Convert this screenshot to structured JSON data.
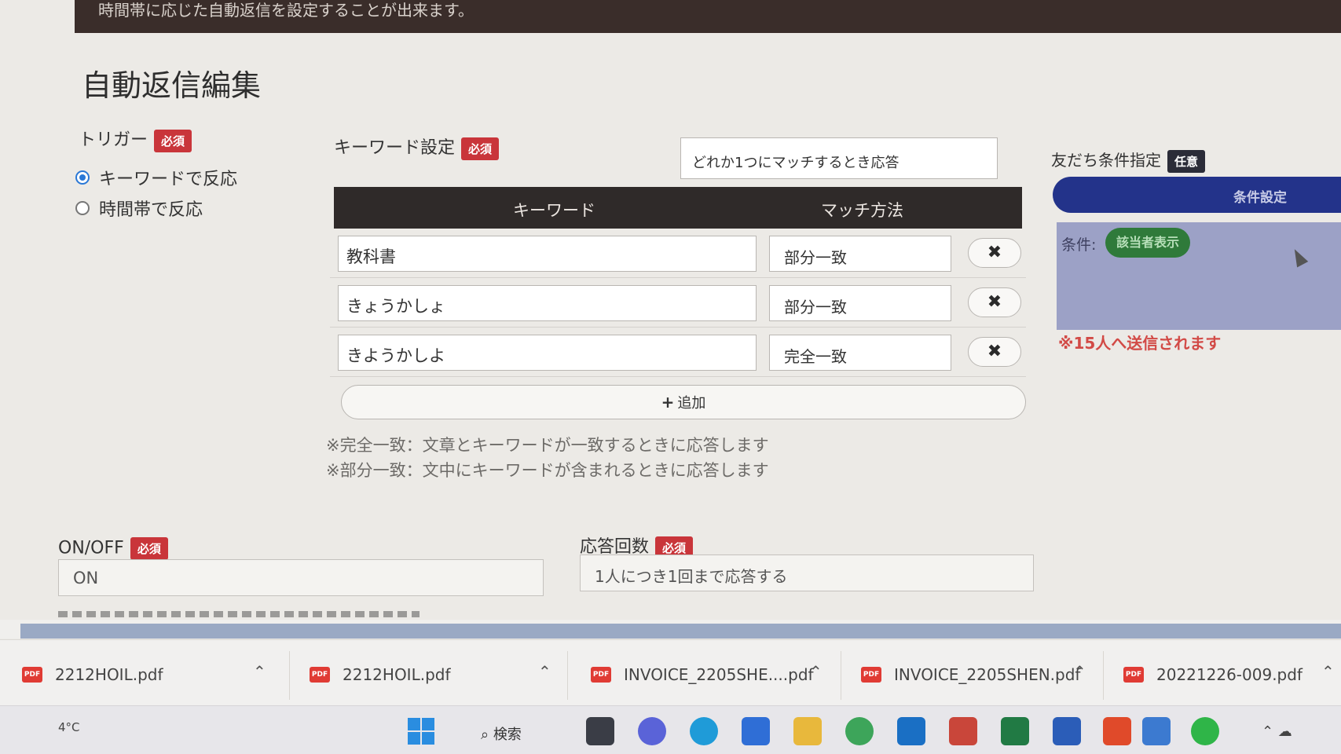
{
  "banner": {
    "text": "時間帯に応じた自動返信を設定することが出来ます。"
  },
  "page": {
    "title": "自動返信編集"
  },
  "badges": {
    "required": "必須",
    "optional": "任意"
  },
  "trigger": {
    "label": "トリガー",
    "options": [
      {
        "label": "キーワードで反応",
        "selected": true
      },
      {
        "label": "時間帯で反応",
        "selected": false
      }
    ]
  },
  "keywords": {
    "label": "キーワード設定",
    "match_mode": "どれか1つにマッチするとき応答",
    "columns": [
      "キーワード",
      "マッチ方法"
    ],
    "rows": [
      {
        "keyword": "教科書",
        "match": "部分一致"
      },
      {
        "keyword": "きょうかしょ",
        "match": "部分一致"
      },
      {
        "keyword": "きようかしよ",
        "match": "完全一致"
      }
    ],
    "delete_symbol": "✖",
    "add_label": "追加",
    "notes": [
      "※完全一致：文章とキーワードが一致するときに応答します",
      "※部分一致：文中にキーワードが含まれるときに応答します"
    ]
  },
  "friends": {
    "label": "友だち条件指定",
    "button": "条件設定",
    "condition_label": "条件:",
    "condition_chip": "該当者表示",
    "warning": "※15人へ送信されます"
  },
  "onoff": {
    "label": "ON/OFF",
    "value": "ON"
  },
  "response_count": {
    "label": "応答回数",
    "value": "1人につき1回まで応答する"
  },
  "downloads": [
    {
      "name": "2212HOIL.pdf"
    },
    {
      "name": "2212HOIL.pdf"
    },
    {
      "name": "INVOICE_2205SHE....pdf"
    },
    {
      "name": "INVOICE_2205SHEN.pdf"
    },
    {
      "name": "20221226-009.pdf"
    }
  ],
  "pdf_label": "PDF",
  "taskbar": {
    "search": "検索",
    "weather": "4°C"
  }
}
